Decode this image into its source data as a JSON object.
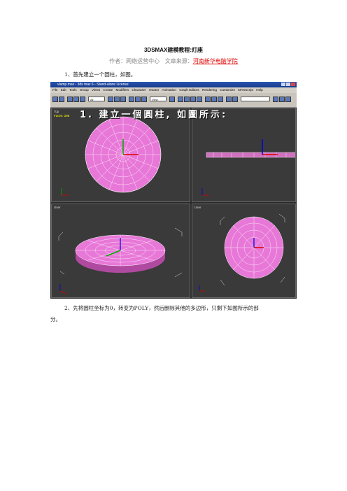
{
  "doc": {
    "title": "3DSMAX建模教程:灯座",
    "author_label": "作者：网络运营中心",
    "source_label": "文章来源：",
    "source_name": "河南新华电脑学院",
    "step1": "1、首先建立一个圆柱，如图。",
    "step2_line1": "2、先将圆柱坐标为0，转变为POLY，然后删除其他的多边形，只剩下如图所示的部",
    "step2_line2": "分。"
  },
  "screenshot": {
    "window_title": "vlamp.max - 3ds max 6 - Stand-alone License",
    "menu": [
      "File",
      "Edit",
      "Tools",
      "Group",
      "Views",
      "Create",
      "Modifiers",
      "Character",
      "reactor",
      "Animation",
      "Graph Editors",
      "Rendering",
      "Customize",
      "MAXScript",
      "Help"
    ],
    "selection_filter": "All",
    "view_dropdown": "View",
    "overlay_text": "1. 建立一個圓柱, 如圖所示:",
    "viewports": {
      "top": {
        "label": "Top",
        "faces": "Faces: 288"
      },
      "front": {
        "label": ""
      },
      "user": {
        "label": "User"
      },
      "persp": {
        "label": "User"
      }
    },
    "colors": {
      "object": "#e878d8",
      "viewport_bg": "#3a3a3a"
    }
  }
}
